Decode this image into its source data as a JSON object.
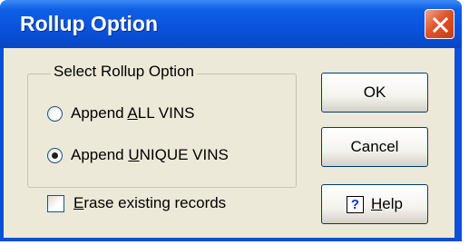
{
  "window": {
    "title": "Rollup Option"
  },
  "group": {
    "title": "Select Rollup Option",
    "options": [
      {
        "prefix": "Append ",
        "accel": "A",
        "rest": "LL VINS",
        "selected": false
      },
      {
        "prefix": "Append ",
        "accel": "U",
        "rest": "NIQUE VINS",
        "selected": true
      }
    ]
  },
  "erase": {
    "accel": "E",
    "rest": "rase existing records",
    "checked": false
  },
  "buttons": {
    "ok": "OK",
    "cancel": "Cancel",
    "help_icon": "?",
    "help_accel": "H",
    "help_rest": "elp"
  },
  "colors": {
    "titlebar": "#0a52dc",
    "close_button": "#e0542d",
    "dialog_face": "#ece9d8",
    "button_border": "#003c74"
  },
  "icons": [
    "close-icon",
    "help-icon"
  ]
}
